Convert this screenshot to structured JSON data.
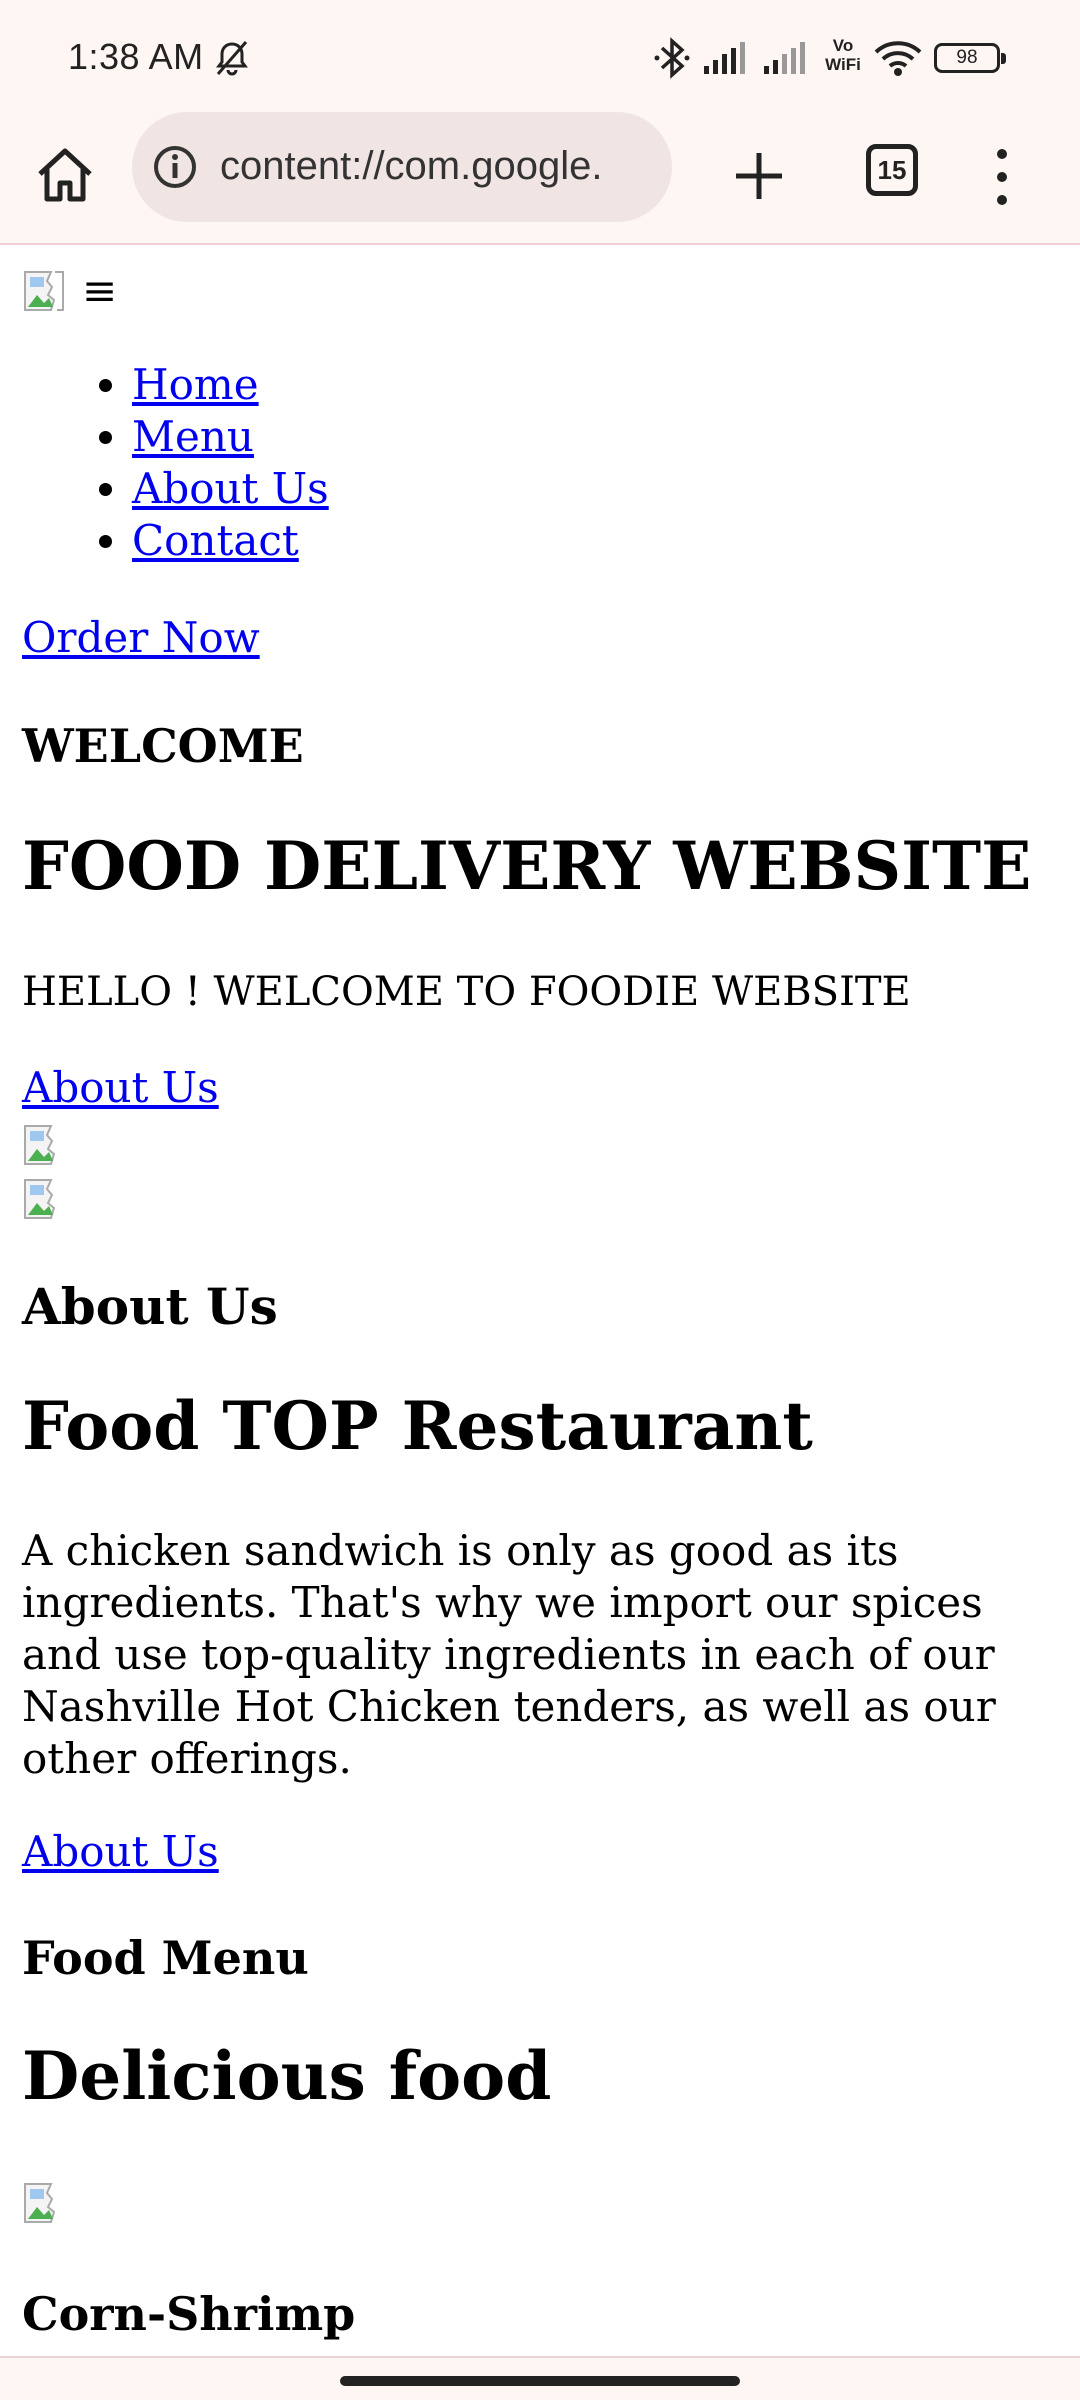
{
  "status_bar": {
    "time": "1:38 AM",
    "vo_wifi": [
      "Vo",
      "WiFi"
    ],
    "battery": "98",
    "icons": [
      "bell-off-icon",
      "bluetooth-icon",
      "signal-icon",
      "signal-icon",
      "wifi-icon"
    ]
  },
  "toolbar": {
    "url": "content://com.google.",
    "tab_count": "15",
    "icons": [
      "home-icon",
      "info-icon",
      "plus-icon",
      "more-icon"
    ]
  },
  "page": {
    "hamburger": "≡",
    "nav": [
      "Home",
      "Menu",
      "About Us",
      "Contact"
    ],
    "order_now": "Order Now",
    "welcome_heading": "WELCOME",
    "main_heading": "FOOD DELIVERY WEBSITE",
    "hello_text": "HELLO ! WELCOME TO FOODIE WEBSITE",
    "about_link_1": "About Us",
    "about_heading": "About Us",
    "restaurant_heading": "Food TOP Restaurant",
    "about_paragraph": "A chicken sandwich is only as good as its ingredients. That's why we import our spices and use top-quality ingredients in each of our Nashville Hot Chicken tenders, as well as our other offerings.",
    "about_link_2": "About Us",
    "menu_heading": "Food Menu",
    "delicious_heading": "Delicious food",
    "item_heading": "Corn-Shrimp"
  },
  "colors": {
    "link": "#0000ee",
    "chrome_bg": "#fdf6f3",
    "urlbar_bg": "#f1e5e4"
  }
}
